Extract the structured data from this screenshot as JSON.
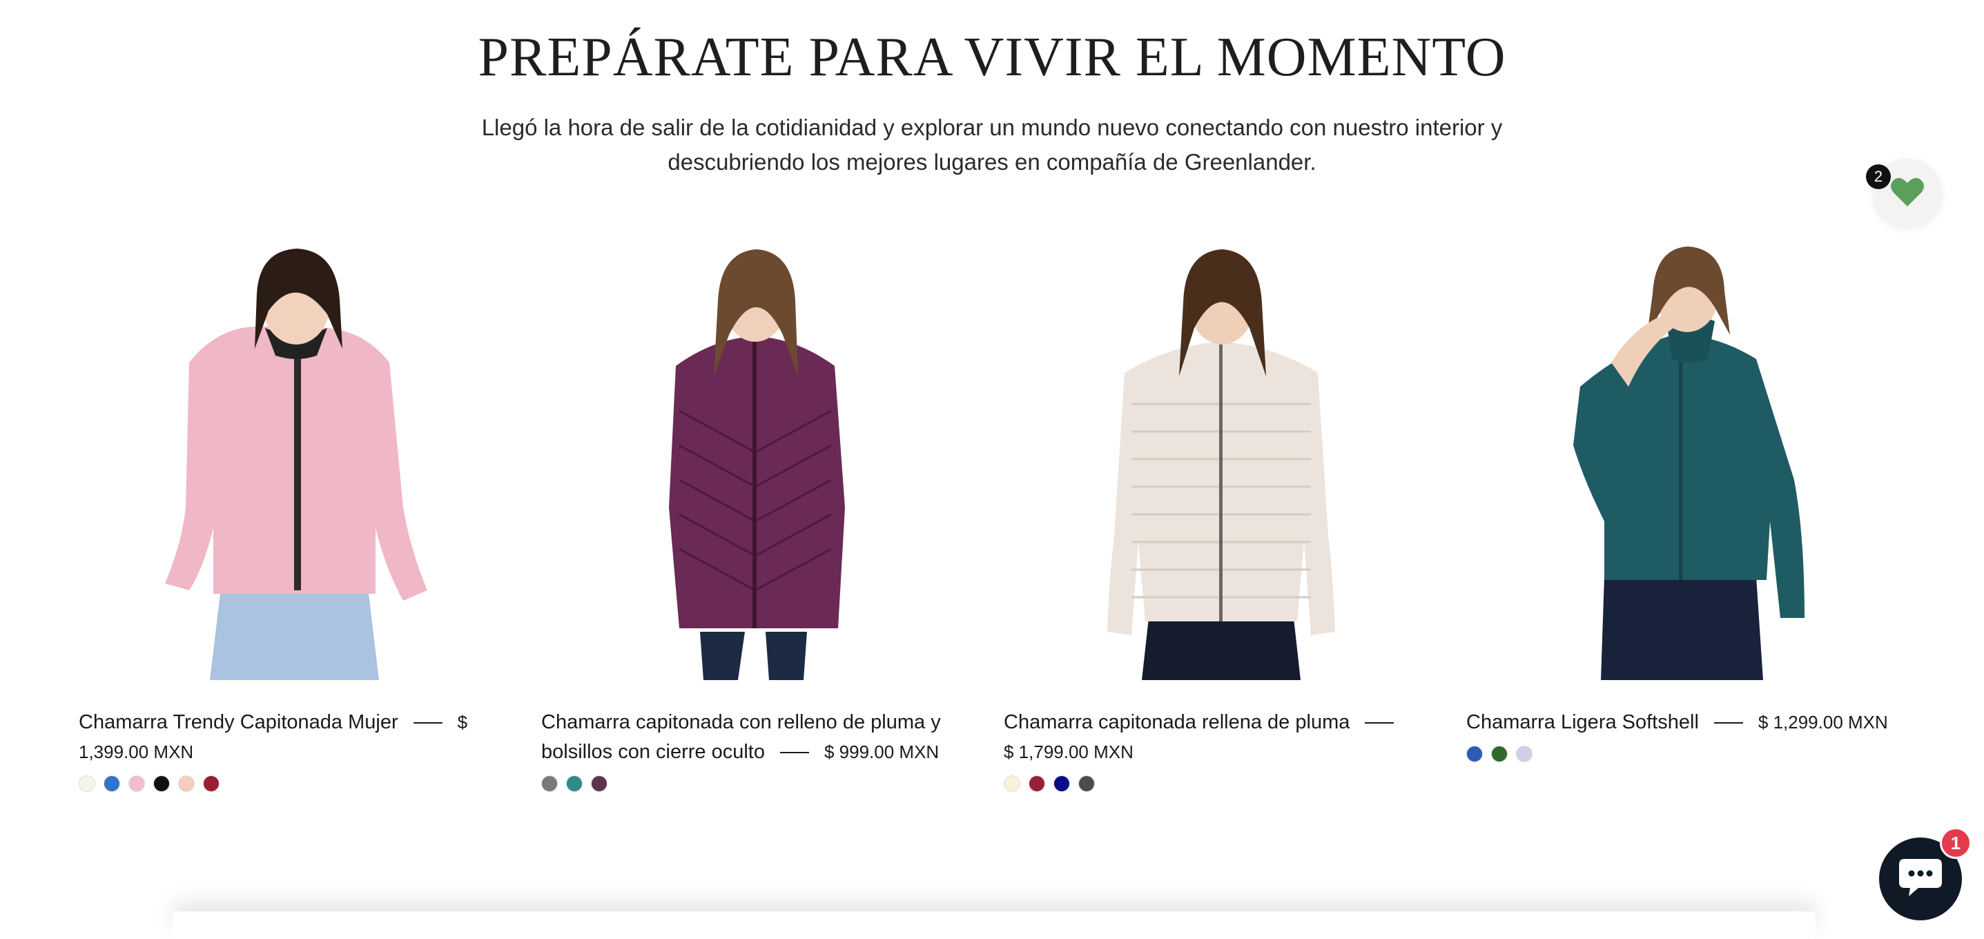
{
  "hero": {
    "title": "PREPÁRATE PARA VIVIR EL MOMENTO",
    "subtitle_line1": "Llegó la hora de salir de la cotidianidad y explorar un mundo nuevo conectando con nuestro interior y",
    "subtitle_line2": "descubriendo los mejores lugares en compañía de Greenlander."
  },
  "products": [
    {
      "name": "Chamarra Trendy Capitonada Mujer",
      "price_part1": "$",
      "price_part2": "1,399.00 MXN",
      "jacket_color": "#f0b7c6",
      "swatches": [
        "#f7f4ec",
        "#2f74c9",
        "#f4bccb",
        "#111111",
        "#f7cdbd",
        "#9a1f33"
      ]
    },
    {
      "name_line1": "Chamarra capitonada con relleno de pluma y",
      "name_line2": "bolsillos con cierre oculto",
      "price": "$ 999.00 MXN",
      "jacket_color": "#6a2a55",
      "swatches": [
        "#7a7a7a",
        "#2f8a8a",
        "#5a3550"
      ]
    },
    {
      "name": "Chamarra capitonada rellena de pluma",
      "price": "$ 1,799.00 MXN",
      "jacket_color": "#ece4dc",
      "swatches": [
        "#f6f3d6",
        "#9a1f3c",
        "#0b0b8a",
        "#4a4f46"
      ]
    },
    {
      "name": "Chamarra Ligera Softshell",
      "price": "$ 1,299.00 MXN",
      "jacket_color": "#1f5b63",
      "swatches": [
        "#2f5ab7",
        "#2d6a2c",
        "#cfd0e6"
      ]
    }
  ],
  "wishlist": {
    "count": "2",
    "icon": "heart-icon",
    "color": "#5aa05a"
  },
  "chat": {
    "count": "1",
    "icon": "chat-bubble-icon"
  }
}
